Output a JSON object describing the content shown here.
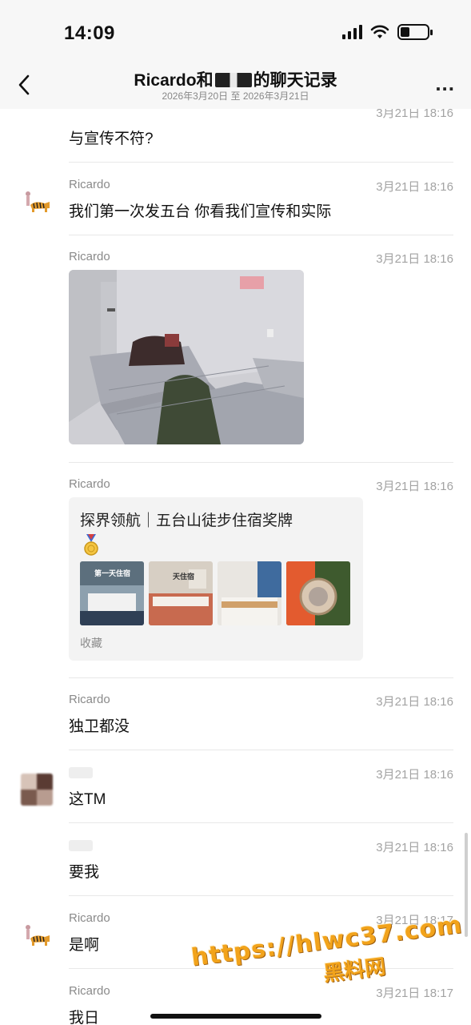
{
  "status_bar": {
    "time": "14:09",
    "battery_level": 0.35
  },
  "nav": {
    "title_left": "Ricardo和",
    "title_right": "的聊天记录",
    "subtitle": "2026年3月20日 至 2026年3月21日",
    "back_icon": "chevron-left-icon",
    "more_label": "..."
  },
  "messages": [
    {
      "sender": "",
      "time": "3月21日 18:16",
      "text": "与宣传不符?"
    },
    {
      "sender": "Ricardo",
      "time": "3月21日 18:16",
      "text": "我们第一次发五台 你看我们宣传和实际"
    },
    {
      "sender": "Ricardo",
      "time": "3月21日 18:16",
      "type": "image"
    },
    {
      "sender": "Ricardo",
      "time": "3月21日 18:16",
      "type": "card",
      "card": {
        "title": "探界领航｜五台山徒步住宿奖牌",
        "footer": "收藏",
        "thumb_labels": [
          "第一天住宿",
          "天住宿"
        ]
      }
    },
    {
      "sender": "Ricardo",
      "time": "3月21日 18:16",
      "text": "独卫都没"
    },
    {
      "sender": "",
      "time": "3月21日 18:16",
      "text": "这TM"
    },
    {
      "sender": "",
      "time": "3月21日 18:16",
      "text": "要我"
    },
    {
      "sender": "Ricardo",
      "time": "3月21日 18:17",
      "text": "是啊"
    },
    {
      "sender": "Ricardo",
      "time": "3月21日 18:17",
      "text": "我日"
    }
  ],
  "watermark": {
    "url": "https://hlwc37.com",
    "name": "黑料网"
  },
  "colors": {
    "accent_watermark": "#f2a31b",
    "nav_bg": "#f7f7f7",
    "card_bg": "#f3f3f3"
  }
}
